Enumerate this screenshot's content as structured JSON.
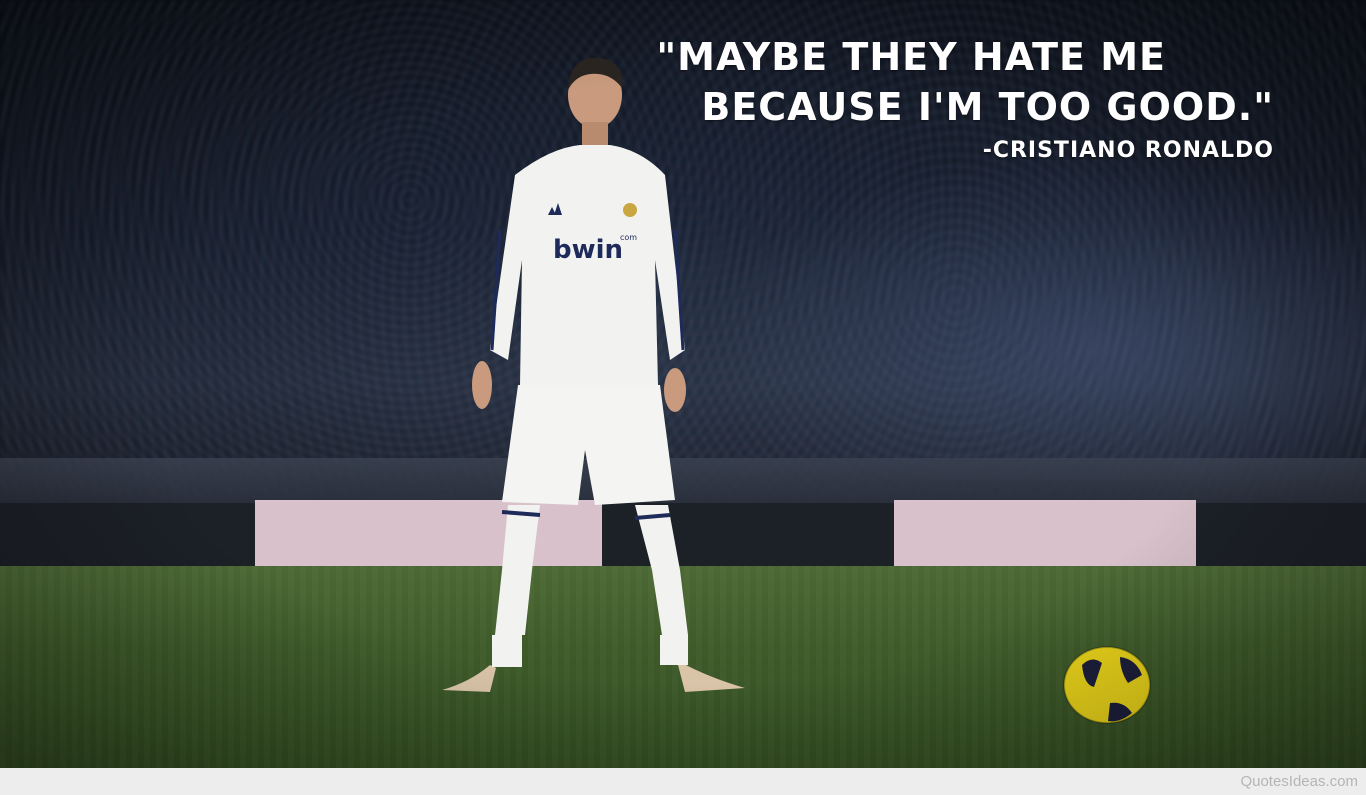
{
  "quote": {
    "line1": "\"MAYBE THEY HATE ME",
    "line2": "BECAUSE I'M TOO GOOD.\"",
    "author": "-CRISTIANO RONALDO"
  },
  "jersey": {
    "sponsor": "bwin",
    "sponsor_suffix": "com"
  },
  "watermark": "QuotesIdeas.com",
  "colors": {
    "quote_text": "#ffffff",
    "pitch": "#3f5c2a",
    "ad_board": "#e8cfd8",
    "ball": "#e8d21a"
  }
}
